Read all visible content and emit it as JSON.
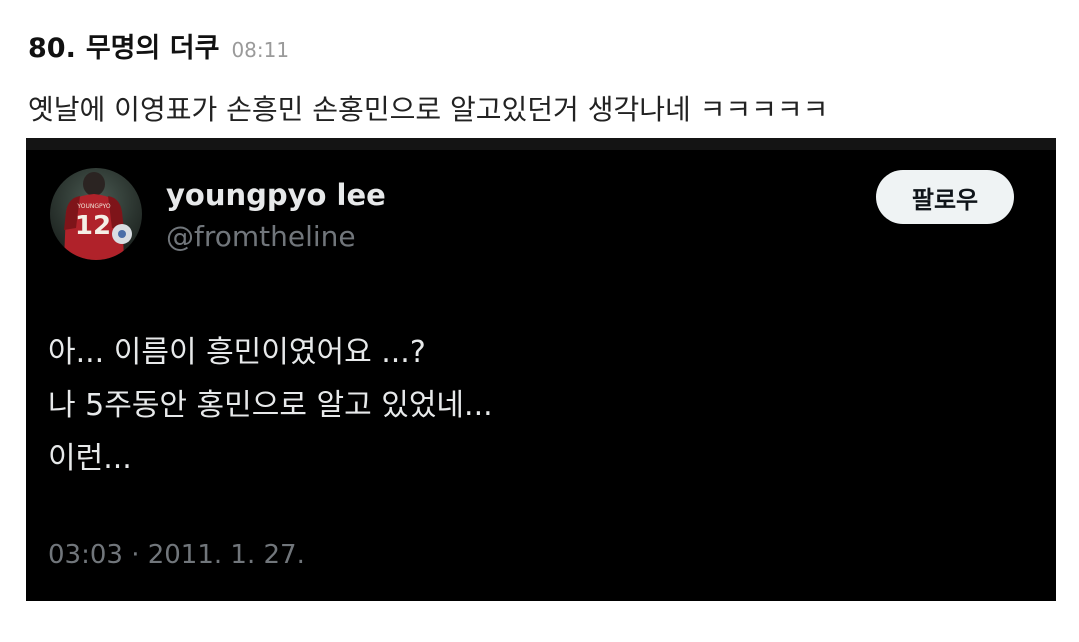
{
  "post": {
    "number": "80.",
    "author": "무명의 더쿠",
    "time": "08:11",
    "body": "옛날에 이영표가 손흥민 손홍민으로 알고있던거 생각나네 ㅋㅋㅋㅋㅋ"
  },
  "tweet": {
    "display_name": "youngpyo lee",
    "handle": "@fromtheline",
    "follow_label": "팔로우",
    "lines": [
      "아... 이름이 흥민이였어요 ...?",
      "나 5주동안 홍민으로 알고 있었네...",
      "이런..."
    ],
    "timestamp": "03:03 · 2011. 1. 27.",
    "avatar": {
      "jersey_number": "12",
      "jersey_name": "YOUNGPYO"
    }
  },
  "colors": {
    "card_background": "#000000",
    "primary_text": "#e7e9ea",
    "secondary_text": "#71767b",
    "follow_button_bg": "#eff3f4",
    "jersey_red": "#b0222a"
  }
}
